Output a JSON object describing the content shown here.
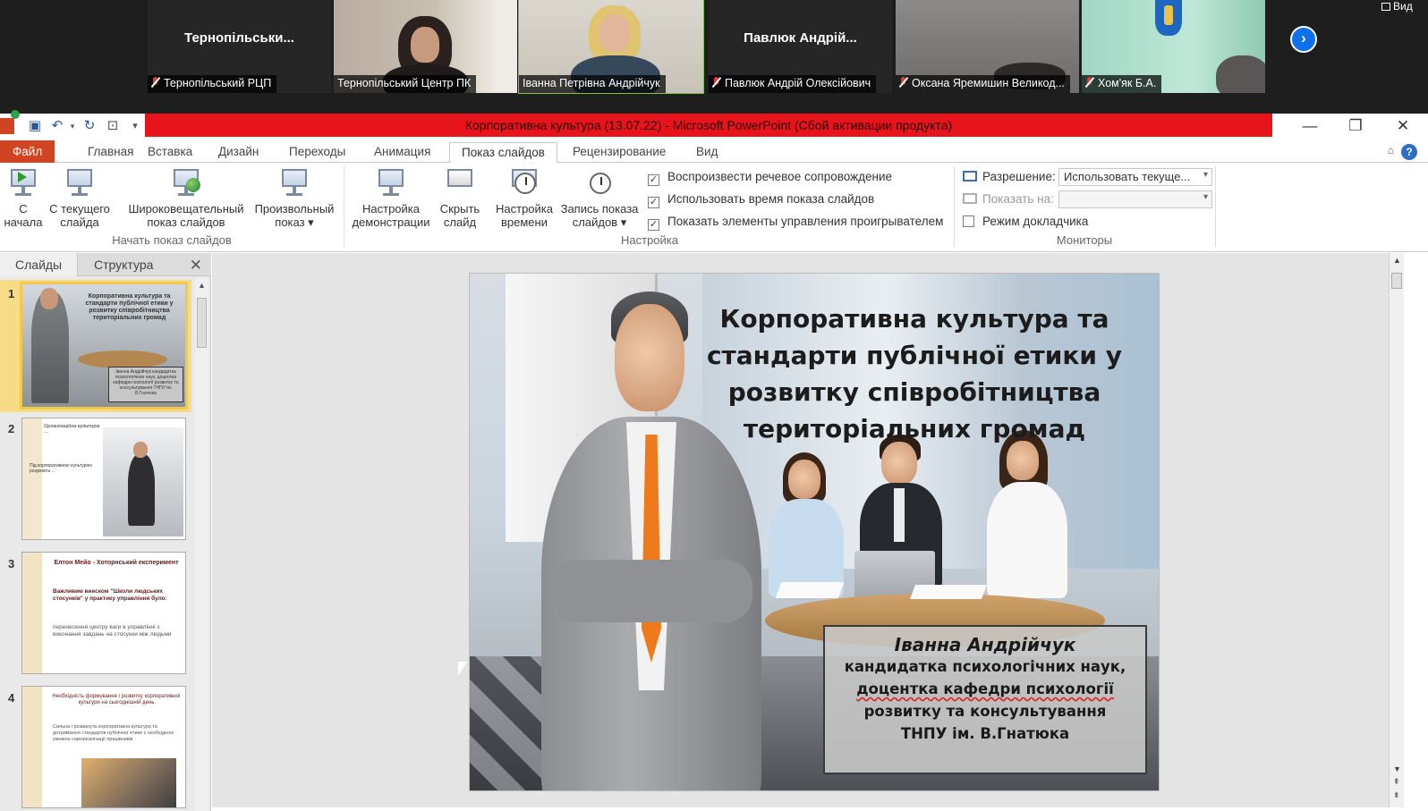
{
  "meeting": {
    "participants": [
      {
        "display_name": "Тернопільськи...",
        "caption": "Тернопільський РЦП",
        "muted": true,
        "video": false
      },
      {
        "display_name": "",
        "caption": "Тернопільський Центр ПК",
        "muted": false,
        "video": true
      },
      {
        "display_name": "",
        "caption": "Іванна Петрівна Андрійчук",
        "muted": false,
        "video": true,
        "active_speaker": true
      },
      {
        "display_name": "Павлюк  Андрій...",
        "caption": "Павлюк Андрій Олексійович",
        "muted": true,
        "video": false
      },
      {
        "display_name": "",
        "caption": "Оксана Яремишин  Великод...",
        "muted": true,
        "video": true
      },
      {
        "display_name": "",
        "caption": "Хом'як Б.А.",
        "muted": true,
        "video": true
      }
    ],
    "view_label": "Вид",
    "next_page_icon": "chevron-right-icon"
  },
  "window": {
    "title": "Корпоративна культура (13.07.22)  -  Microsoft PowerPoint (Сбой активации продукта)",
    "title_bar_color": "#e8141c",
    "controls": {
      "minimize": "—",
      "restore": "❐",
      "close": "✕"
    }
  },
  "ribbon": {
    "tabs": [
      "Файл",
      "Главная",
      "Вставка",
      "Дизайн",
      "Переходы",
      "Анимация",
      "Показ слайдов",
      "Рецензирование",
      "Вид"
    ],
    "selected_tab": "Показ слайдов",
    "groups": {
      "start": {
        "label": "Начать показ слайдов",
        "from_start": [
          "С",
          "начала"
        ],
        "from_current": [
          "С текущего",
          "слайда"
        ],
        "broadcast": [
          "Широковещательный",
          "показ слайдов"
        ],
        "custom": [
          "Произвольный",
          "показ ▾"
        ]
      },
      "setup": {
        "label": "Настройка",
        "setup_show": [
          "Настройка",
          "демонстрации"
        ],
        "hide_slide": [
          "Скрыть",
          "слайд"
        ],
        "rehearse": [
          "Настройка",
          "времени"
        ],
        "record": [
          "Запись показа",
          "слайдов ▾"
        ],
        "checks": [
          {
            "label": "Воспроизвести речевое сопровождение",
            "checked": true
          },
          {
            "label": "Использовать время показа слайдов",
            "checked": true
          },
          {
            "label": "Показать элементы управления проигрывателем",
            "checked": true
          }
        ]
      },
      "monitors": {
        "label": "Мониторы",
        "resolution_label": "Разрешение:",
        "resolution_value": "Использовать текуще...",
        "show_on_label": "Показать на:",
        "show_on_value": "",
        "presenter_view": {
          "label": "Режим докладчика",
          "checked": false
        }
      }
    }
  },
  "left_panel": {
    "tabs": [
      "Слайды",
      "Структура"
    ],
    "selected_tab": "Слайды",
    "close": "✕",
    "slides": [
      {
        "num": "1",
        "title": "Корпоративна культура та стандарти публічної етики у розвитку співробітництва територіальних громад",
        "box": "Іванна Андрійчук кандидатка психологічних наук, доцентка кафедри психології розвитку та консультування ТНПУ ім. В.Гнатюка"
      },
      {
        "num": "2",
        "title": "Організаційна культура ...",
        "body": "Під корпоративною культурою розуміють ..."
      },
      {
        "num": "3",
        "title": "Елтон Мейо - Хоторнський експеримент",
        "bullet1": "Важливим внеском \"Школи людських стосунків\" у практику управління було:",
        "bullet2": "перенесення центру ваги в управлінні з виконання завдань на стосунки між людьми"
      },
      {
        "num": "4",
        "title": "Необхідність формування і розвитку корпоративної культури на сьогоднішній день",
        "bullet1": "Сильна і розвинута корпоративна культура та дотримання стандартів публічної етики є необхідною умовою самореалізації працівників"
      }
    ]
  },
  "slide": {
    "title": "Корпоративна культура та стандарти публічної етики у розвитку співробітництва територіальних громад",
    "author_name": "Іванна Андрійчук",
    "author_lines": [
      "кандидатка психологічних наук,",
      "доцентка кафедри психології",
      "розвитку та консультування",
      "ТНПУ ім. В.Гнатюка"
    ]
  }
}
